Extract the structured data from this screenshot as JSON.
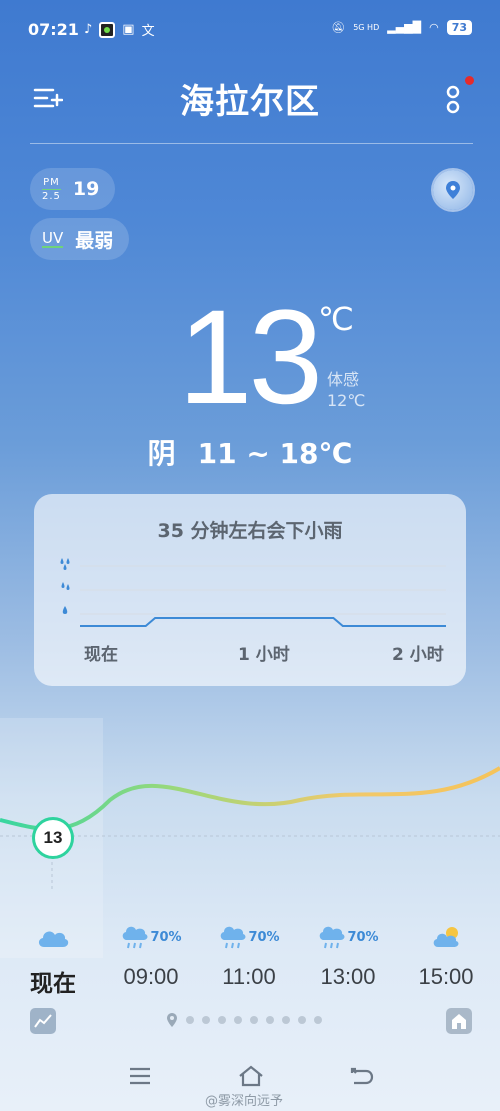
{
  "status_bar": {
    "time": "07:21",
    "network": "5G HD",
    "battery": "73"
  },
  "header": {
    "title": "海拉尔区"
  },
  "air": {
    "pm_label_top": "PM",
    "pm_label_bottom": "2.5",
    "pm_value": "19",
    "uv_label": "UV",
    "uv_value": "最弱"
  },
  "current": {
    "temp": "13",
    "unit": "℃",
    "feels_label": "体感",
    "feels_value": "12℃",
    "condition": "阴",
    "range": "11 ~ 18℃"
  },
  "rain_card": {
    "title": "35 分钟左右会下小雨",
    "x_labels": [
      "现在",
      "1 小时",
      "2 小时"
    ],
    "chart_data": {
      "type": "line",
      "x_labels": [
        "现在",
        "1 小时",
        "2 小时"
      ],
      "levels": [
        0,
        0,
        0,
        0,
        0,
        0,
        0,
        0,
        1,
        1,
        1,
        1,
        1,
        1,
        1,
        1,
        1,
        1,
        1,
        1,
        1,
        1,
        1,
        1,
        1,
        1,
        1,
        1,
        0,
        0,
        0,
        0,
        0,
        0,
        0,
        0,
        0,
        0,
        0,
        0
      ],
      "colors": {
        "line": "#3d8ad6"
      }
    }
  },
  "hourly": [
    {
      "time": "现在",
      "icon": "cloud-icon",
      "precip": "",
      "temp": "13"
    },
    {
      "time": "09:00",
      "icon": "rain-cloud-icon",
      "precip": "70%"
    },
    {
      "time": "11:00",
      "icon": "rain-cloud-icon",
      "precip": "70%"
    },
    {
      "time": "13:00",
      "icon": "rain-cloud-icon",
      "precip": "70%"
    },
    {
      "time": "15:00",
      "icon": "partly-sunny-icon",
      "precip": ""
    }
  ],
  "watermark": "@雾深向远予",
  "colors": {
    "accent_green": "#2ed39e",
    "red_dot": "#e52b2b",
    "precip_blue": "#3d8ad6"
  }
}
